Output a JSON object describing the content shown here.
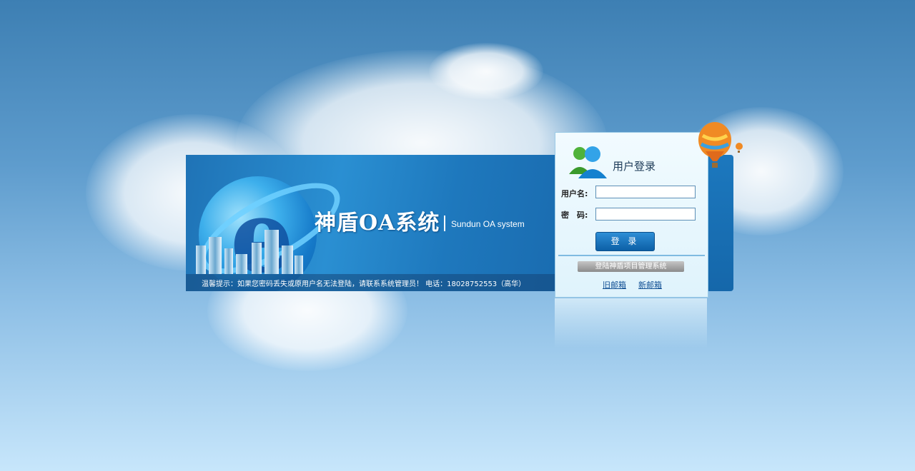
{
  "banner": {
    "title": "神盾OA系统",
    "subtitle": "Sundun OA system",
    "tip": "温馨提示：如果您密码丢失或原用户名无法登陆，请联系系统管理员！  电话：18028752553（高华）"
  },
  "login": {
    "title": "用户登录",
    "username_label": "用户名:",
    "password_label": "密　码:",
    "username_value": "",
    "password_value": "",
    "submit_label": "登 录",
    "oa_link_label": "登陆神盾项目管理系统",
    "old_mail_label": "旧邮箱",
    "new_mail_label": "新邮箱"
  },
  "colors": {
    "accent": "#1f73b6",
    "button": "#0c5fa6",
    "link": "#0d4d92"
  },
  "icons": [
    "users-icon",
    "globe-logo-icon",
    "hot-air-balloon-icon",
    "city-skyline-image"
  ]
}
